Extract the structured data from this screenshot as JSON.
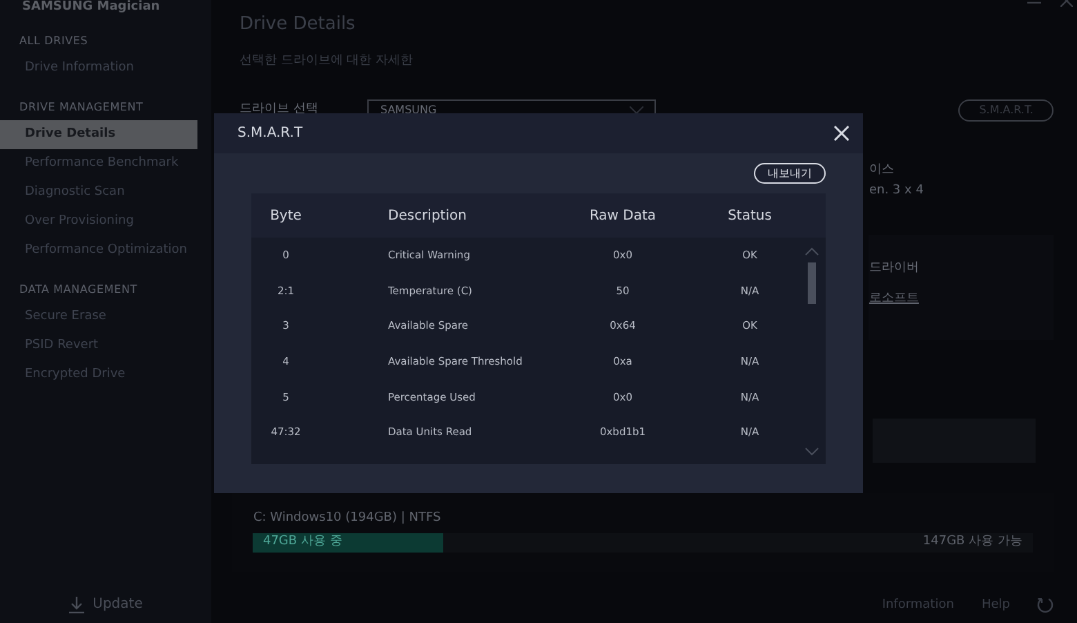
{
  "app": {
    "title": "SAMSUNG Magician"
  },
  "sidebar": {
    "sections": [
      {
        "heading": "ALL DRIVES",
        "items": [
          {
            "label": "Drive Information",
            "selected": false
          }
        ]
      },
      {
        "heading": "DRIVE MANAGEMENT",
        "items": [
          {
            "label": "Drive Details",
            "selected": true
          },
          {
            "label": "Performance Benchmark",
            "selected": false
          },
          {
            "label": "Diagnostic Scan",
            "selected": false
          },
          {
            "label": "Over Provisioning",
            "selected": false
          },
          {
            "label": "Performance Optimization",
            "selected": false
          }
        ]
      },
      {
        "heading": "DATA MANAGEMENT",
        "items": [
          {
            "label": "Secure Erase",
            "selected": false
          },
          {
            "label": "PSID Revert",
            "selected": false
          },
          {
            "label": "Encrypted Drive",
            "selected": false
          }
        ]
      }
    ],
    "update": "Update"
  },
  "page": {
    "title": "Drive Details",
    "subtitle": "선택한 드라이브에 대한 자세한",
    "drive_select": {
      "label": "드라이브 선택",
      "value": "SAMSUNG"
    },
    "smart_button": "S.M.A.R.T.",
    "interface": {
      "label": "이스",
      "value": "en. 3 x 4"
    },
    "driver": {
      "label": "드라이버",
      "link": "로소프트"
    },
    "partition": {
      "name": "C: Windows10 (194GB)  |  NTFS",
      "used": "47GB 사용 중",
      "free": "147GB 사용 가능",
      "level": 0.243
    }
  },
  "footer": {
    "links": [
      "Information",
      "Help"
    ]
  },
  "modal": {
    "title": "S.M.A.R.T",
    "export_button": "내보내기",
    "columns": [
      "Byte",
      "Description",
      "Raw Data",
      "Status"
    ],
    "rows": [
      [
        "0",
        "Critical Warning",
        "0x0",
        "OK"
      ],
      [
        "2:1",
        "Temperature (C)",
        "50",
        "N/A"
      ],
      [
        "3",
        "Available Spare",
        "0x64",
        "OK"
      ],
      [
        "4",
        "Available Spare Threshold",
        "0xa",
        "N/A"
      ],
      [
        "5",
        "Percentage Used",
        "0x0",
        "N/A"
      ],
      [
        "47:32",
        "Data Units Read",
        "0xbd1b1",
        "N/A"
      ]
    ]
  }
}
